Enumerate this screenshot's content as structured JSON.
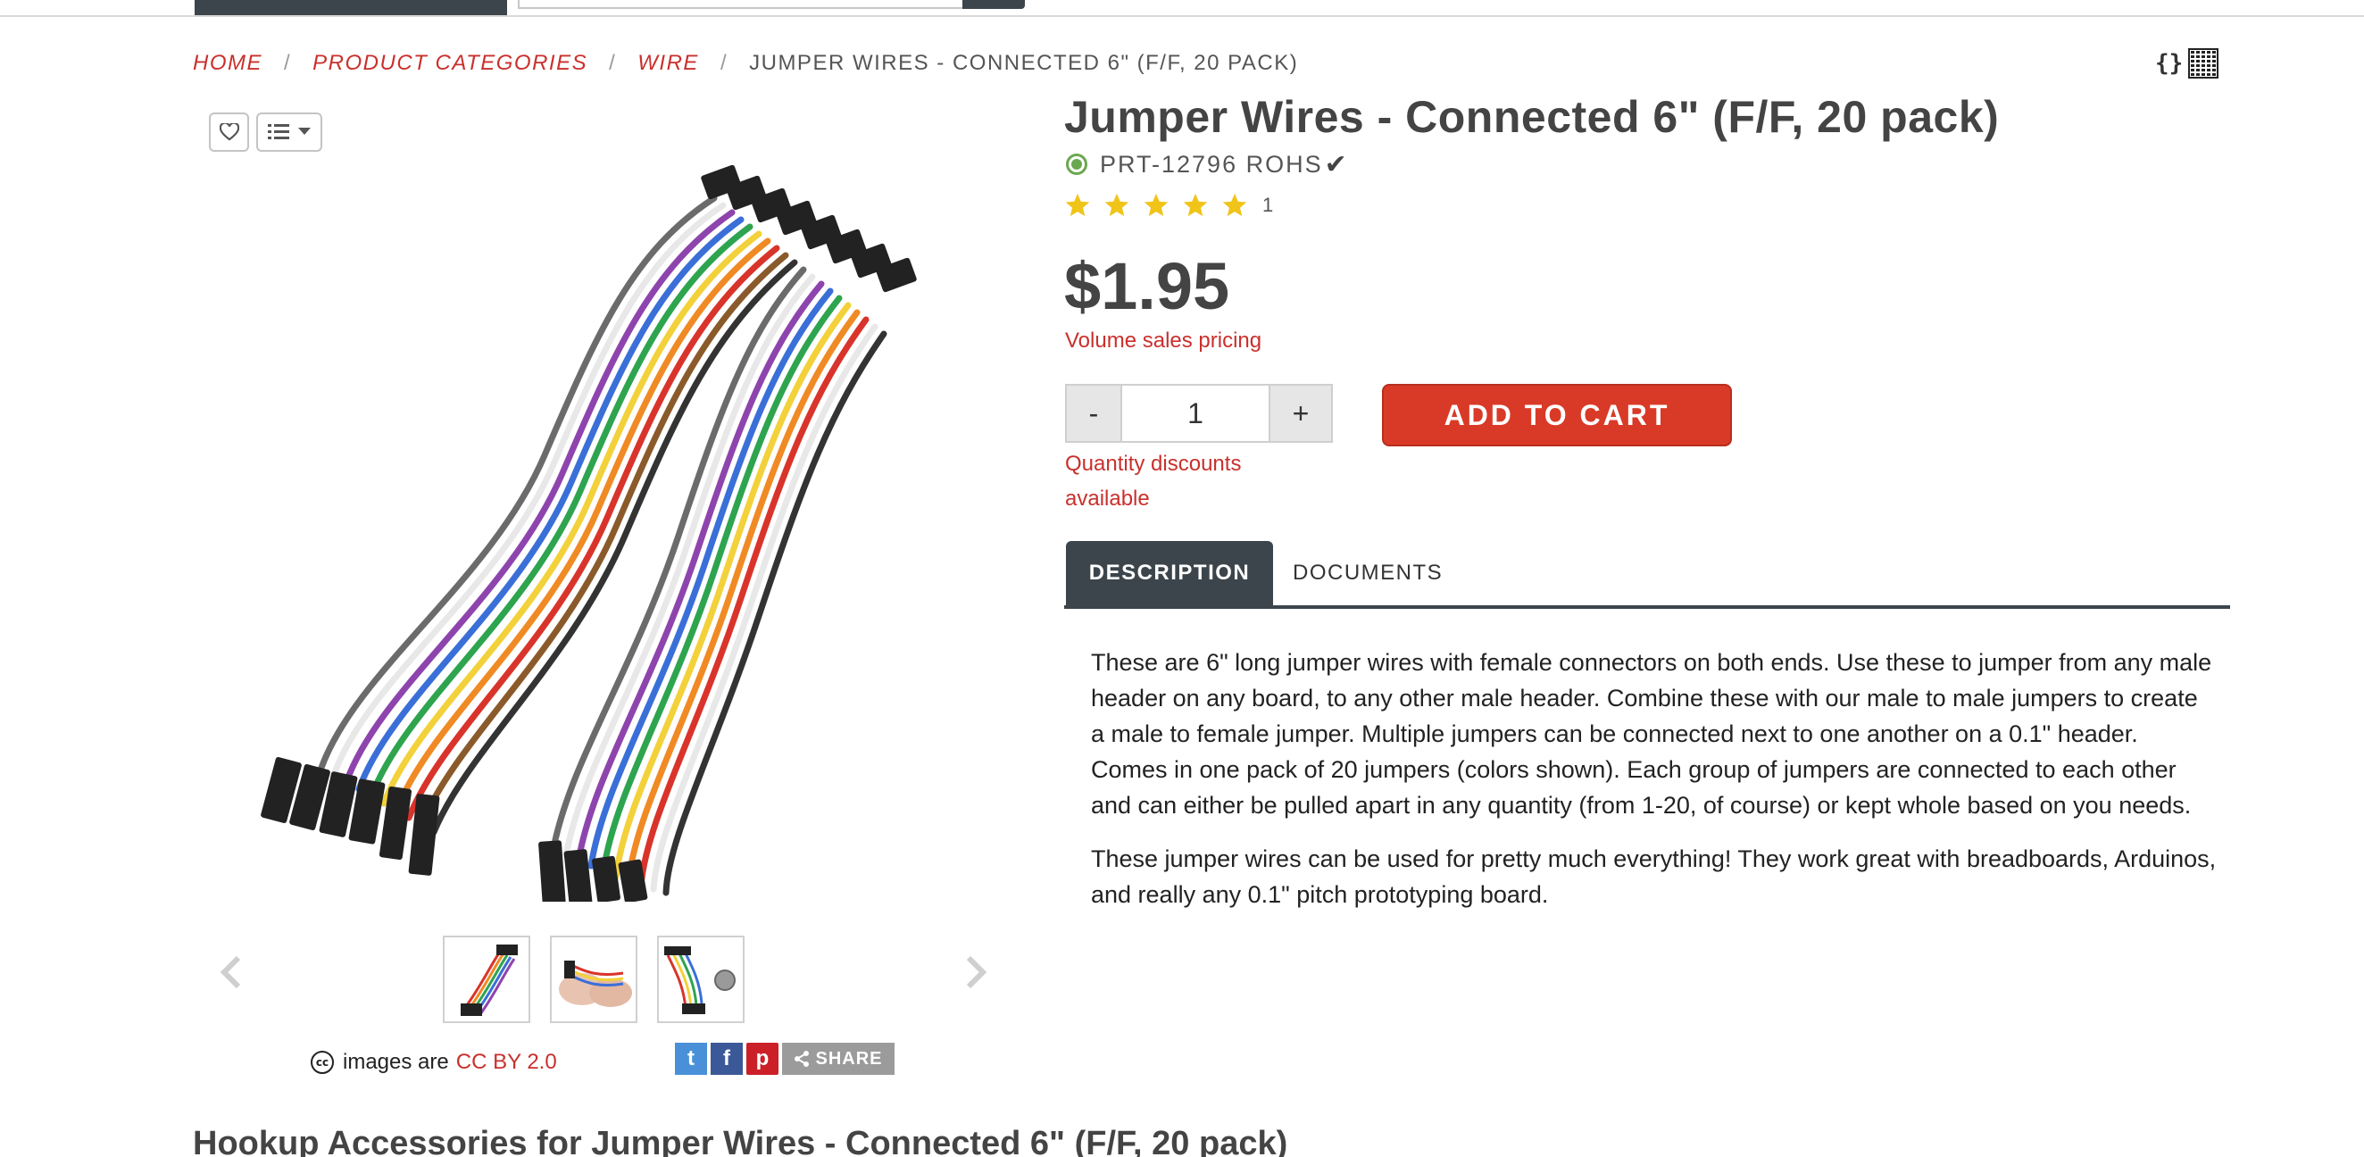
{
  "breadcrumb": {
    "items": [
      {
        "label": "HOME"
      },
      {
        "label": "PRODUCT CATEGORIES"
      },
      {
        "label": "WIRE"
      }
    ],
    "separator": "/",
    "current": "JUMPER WIRES - CONNECTED 6\" (F/F, 20 PACK)"
  },
  "toolbar": {
    "code_icon_label": "{}"
  },
  "product": {
    "title": "Jumper Wires - Connected 6\" (F/F, 20 pack)",
    "sku": "PRT-12796 ROHS",
    "rohs_check": "✔",
    "rating": 5,
    "review_count": "1",
    "price": "$1.95",
    "volume_pricing": "Volume sales pricing",
    "stock_color": "#6aa84f",
    "star_color": "#f0c419"
  },
  "cart": {
    "minus": "-",
    "quantity": "1",
    "plus": "+",
    "quantity_discount": "Quantity discounts available",
    "add_to_cart": "ADD TO CART",
    "button_color": "#d93a27"
  },
  "tabs": [
    {
      "label": "DESCRIPTION",
      "active": true
    },
    {
      "label": "DOCUMENTS",
      "active": false
    }
  ],
  "description": {
    "p1": "These are 6\" long jumper wires with female connectors on both ends. Use these to jumper from any male header on any board, to any other male header. Combine these with our male to male jumpers to create a male to female jumper. Multiple jumpers can be connected next to one another on a 0.1\" header. Comes in one pack of 20 jumpers (colors shown). Each group of jumpers are connected to each other and can either be pulled apart in any quantity (from 1-20, of course) or kept whole based on you needs.",
    "p2": "These jumper wires can be used for pretty much everything! They work great with breadboards, Arduinos, and really any 0.1\" pitch prototyping board."
  },
  "gallery": {
    "license_prefix": "images are",
    "license_link": "CC BY 2.0",
    "cc_badge": "cc",
    "share_label": "SHARE",
    "twitter_glyph": "t",
    "facebook_glyph": "f",
    "pinterest_glyph": "p"
  },
  "hookup": {
    "title": "Hookup Accessories for Jumper Wires - Connected 6\" (F/F, 20 pack)"
  },
  "theme": {
    "accent_red": "#c9302c",
    "dark_nav": "#3d454c"
  }
}
